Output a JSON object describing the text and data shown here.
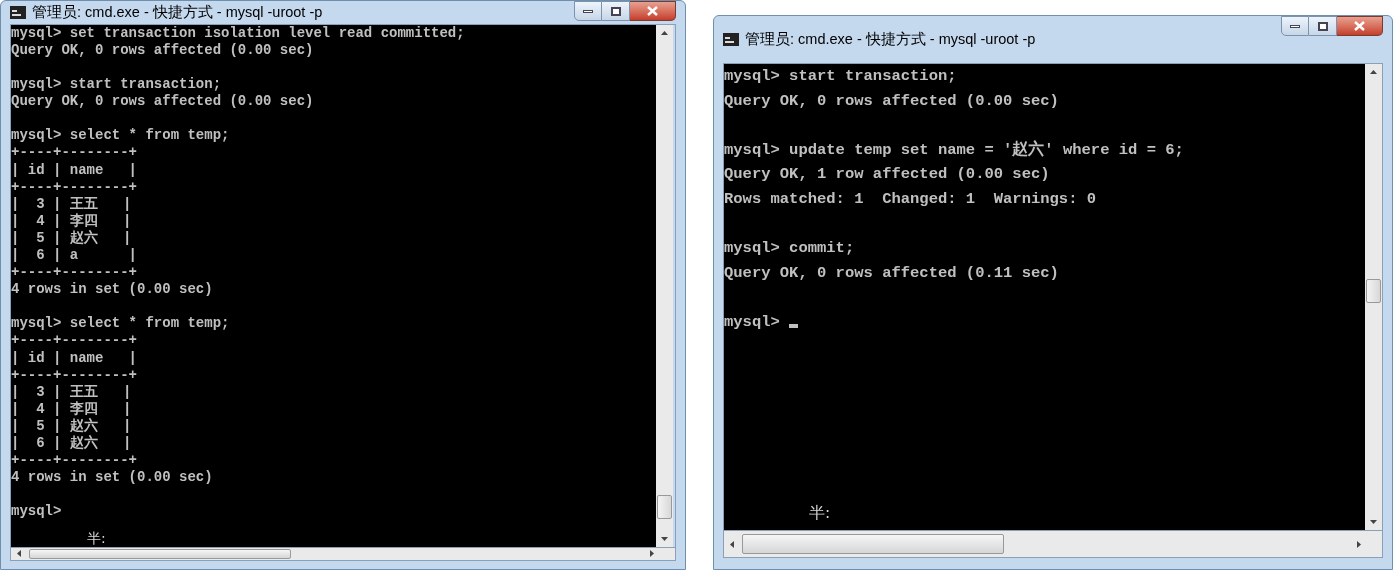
{
  "windows": [
    {
      "title": "管理员: cmd.exe - 快捷方式 - mysql  -uroot -p",
      "cursor": false,
      "blocks": [
        [
          "mysql> set transaction isolation level read committed;",
          "Query OK, 0 rows affected (0.00 sec)"
        ],
        [
          "mysql> start transaction;",
          "Query OK, 0 rows affected (0.00 sec)"
        ],
        [
          "mysql> select * from temp;",
          "+----+--------+",
          "| id | name   |",
          "+----+--------+",
          "|  3 | 王五   |",
          "|  4 | 李四   |",
          "|  5 | 赵六   |",
          "|  6 | a      |",
          "+----+--------+",
          "4 rows in set (0.00 sec)"
        ],
        [
          "mysql> select * from temp;",
          "+----+--------+",
          "| id | name   |",
          "+----+--------+",
          "|  3 | 王五   |",
          "|  4 | 李四   |",
          "|  5 | 赵六   |",
          "|  6 | 赵六   |",
          "+----+--------+",
          "4 rows in set (0.00 sec)"
        ],
        [
          "mysql>"
        ]
      ],
      "ime_status": "半:"
    },
    {
      "title": "管理员: cmd.exe - 快捷方式 - mysql  -uroot -p",
      "cursor": true,
      "blocks": [
        [
          "mysql> start transaction;",
          "Query OK, 0 rows affected (0.00 sec)"
        ],
        [
          "mysql> update temp set name = '赵六' where id = 6;",
          "Query OK, 1 row affected (0.00 sec)",
          "Rows matched: 1  Changed: 1  Warnings: 0"
        ],
        [
          "mysql> commit;",
          "Query OK, 0 rows affected (0.11 sec)"
        ],
        [
          "mysql>"
        ]
      ],
      "ime_status": "半:"
    }
  ]
}
